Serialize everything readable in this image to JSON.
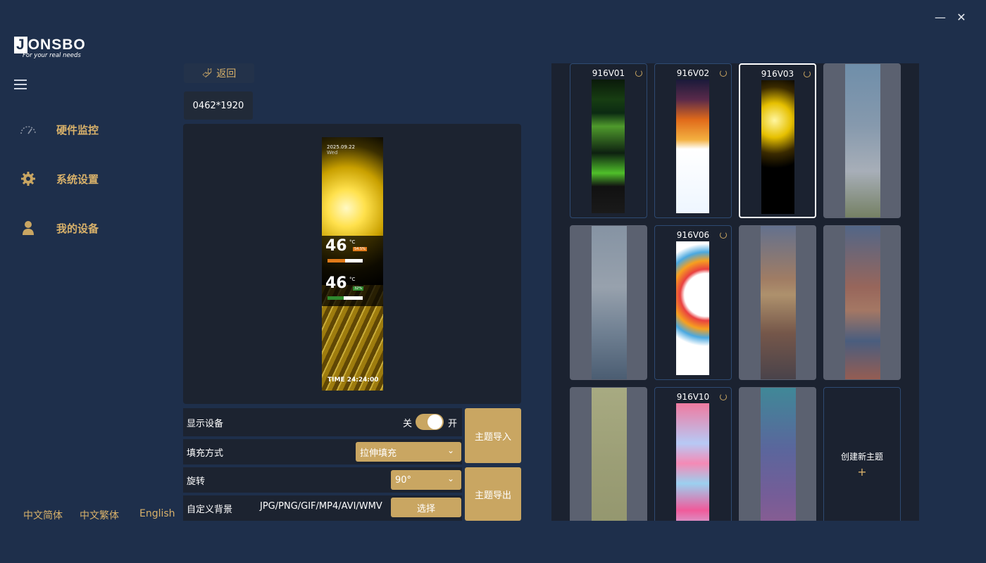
{
  "window": {
    "minimize_icon": "minimize-icon",
    "close_icon": "close-icon"
  },
  "logo": {
    "brand_first": "J",
    "brand_rest": "ONSBO",
    "tagline": "For your real needs"
  },
  "sidebar": {
    "items": [
      {
        "label": "硬件监控",
        "icon": "speedometer-icon"
      },
      {
        "label": "系统设置",
        "icon": "gear-icon"
      },
      {
        "label": "我的设备",
        "icon": "user-icon"
      }
    ],
    "languages": [
      "中文简体",
      "中文繁体",
      "English"
    ]
  },
  "main": {
    "back_label": "返回",
    "resolution": "0462*1920",
    "preview": {
      "date": "2025.09.22",
      "day": "Wed",
      "temp1": "46",
      "temp1_unit": "°C",
      "temp1_badge": "54.5%",
      "temp1_progress": 0.5,
      "temp2": "46",
      "temp2_unit": "°C",
      "temp2_badge": "32%",
      "temp2_progress": 0.45,
      "time": "TIME 24:24:00"
    },
    "settings": {
      "display_label": "显示设备",
      "toggle_off": "关",
      "toggle_on": "开",
      "display_on": true,
      "fill_label": "填充方式",
      "fill_value": "拉伸填充",
      "rotate_label": "旋转",
      "rotate_value": "90°",
      "bg_label": "自定义背景",
      "bg_formats": "JPG/PNG/GIF/MP4/AVI/WMV",
      "choose_label": "选择",
      "import_label": "主题导入",
      "export_label": "主题导出"
    }
  },
  "themes": {
    "cards": [
      {
        "title": "916V01",
        "state": "active"
      },
      {
        "title": "916V02",
        "state": "active"
      },
      {
        "title": "916V03",
        "state": "selected"
      },
      {
        "title": "",
        "state": "dim"
      },
      {
        "title": "",
        "state": "dim"
      },
      {
        "title": "916V06",
        "state": "active"
      },
      {
        "title": "",
        "state": "dim"
      },
      {
        "title": "",
        "state": "dim"
      },
      {
        "title": "",
        "state": "dim"
      },
      {
        "title": "916V10",
        "state": "active"
      },
      {
        "title": "",
        "state": "dim"
      }
    ],
    "create_label": "创建新主题",
    "create_plus": "+"
  },
  "colors": {
    "background": "#1e2f4b",
    "accent": "#c9a662",
    "accent_text": "#d8b16a",
    "panel": "#1c2330"
  }
}
